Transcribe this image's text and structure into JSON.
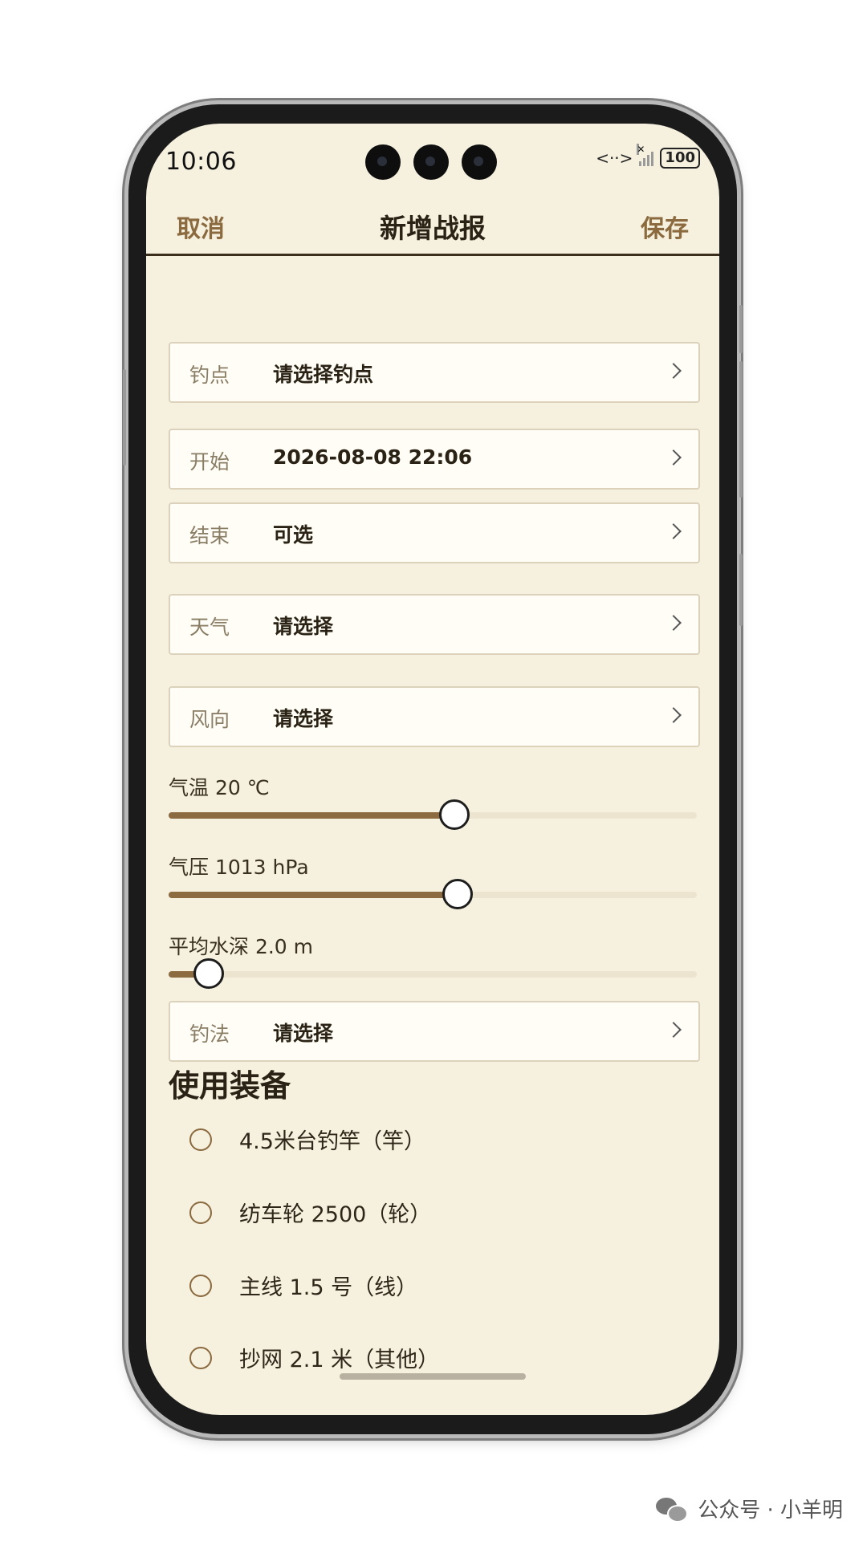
{
  "status_bar": {
    "time": "10:06",
    "battery": "100"
  },
  "nav": {
    "cancel": "取消",
    "title": "新增战报",
    "save": "保存"
  },
  "fields": {
    "spot": {
      "label": "钓点",
      "value": "请选择钓点"
    },
    "start": {
      "label": "开始",
      "value": "2026-08-08 22:06"
    },
    "end": {
      "label": "结束",
      "value": "可选"
    },
    "weather": {
      "label": "天气",
      "value": "请选择"
    },
    "wind": {
      "label": "风向",
      "value": "请选择"
    },
    "method": {
      "label": "钓法",
      "value": "请选择"
    }
  },
  "sliders": {
    "temperature": {
      "label": "气温 20 ℃",
      "fraction": 0.54
    },
    "pressure": {
      "label": "气压 1013 hPa",
      "fraction": 0.545
    },
    "depth": {
      "label": "平均水深 2.0 m",
      "fraction": 0.074
    }
  },
  "equipment": {
    "title": "使用装备",
    "items": [
      {
        "label": "4.5米台钓竿（竿）",
        "checked": false
      },
      {
        "label": "纺车轮 2500（轮）",
        "checked": false
      },
      {
        "label": "主线 1.5 号（线）",
        "checked": false
      },
      {
        "label": "抄网 2.1 米（其他）",
        "checked": false
      }
    ]
  },
  "watermark": {
    "text": "公众号 · 小羊明"
  },
  "colors": {
    "background": "#f6f0df",
    "accent": "#8a6a3e",
    "slider_fill": "#8b6b3f"
  }
}
